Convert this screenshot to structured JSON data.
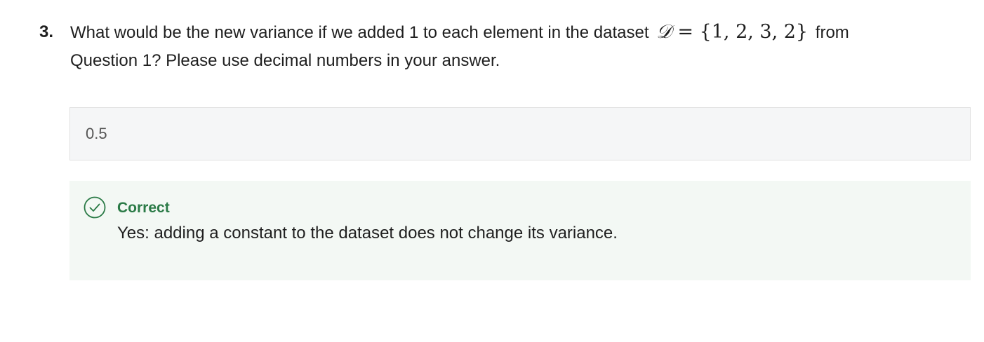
{
  "question": {
    "number": "3.",
    "text_before": "What would be the new variance if we added 1 to each element in the dataset",
    "math_symbol": "𝒟",
    "math_expr": "= {1, 2, 3, 2}",
    "text_after": "from Question 1? Please use decimal numbers in your answer."
  },
  "answer": {
    "value": "0.5"
  },
  "feedback": {
    "status": "Correct",
    "message": "Yes: adding a constant to the dataset does not change its variance.",
    "status_color": "#2a7a46",
    "icon": "check-circle-icon"
  }
}
